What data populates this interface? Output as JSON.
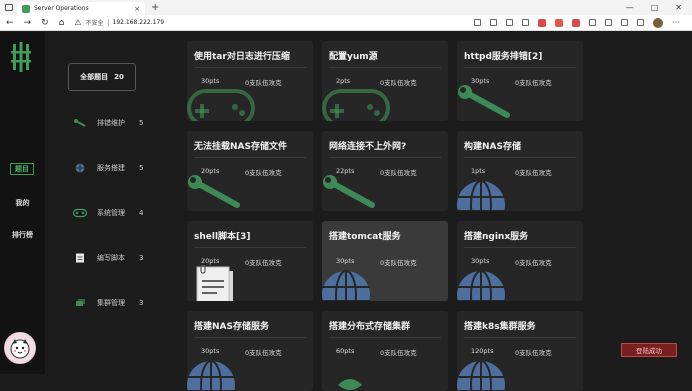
{
  "browser": {
    "tab_title": "Server Operations",
    "tab_close": "×",
    "new_tab": "+",
    "insecure_label": "不安全",
    "url": "192.168.222.179"
  },
  "rail": {
    "items": [
      {
        "label": "题目",
        "active": true
      },
      {
        "label": "我的",
        "active": false
      },
      {
        "label": "排行榜",
        "active": false
      }
    ]
  },
  "categories": {
    "all": {
      "label": "全部题目",
      "count": "20"
    },
    "items": [
      {
        "label": "排错维护",
        "count": "5",
        "icon": "wrench-icon"
      },
      {
        "label": "服务搭建",
        "count": "5",
        "icon": "globe-icon"
      },
      {
        "label": "系统管理",
        "count": "4",
        "icon": "gamepad-icon"
      },
      {
        "label": "编写脚本",
        "count": "3",
        "icon": "document-icon"
      },
      {
        "label": "集群管理",
        "count": "3",
        "icon": "cluster-icon"
      }
    ]
  },
  "challenges": [
    {
      "title": "使用tar对日志进行压缩",
      "pts": "30pts",
      "solves": "0支队伍攻克",
      "icon": "gamepad-icon"
    },
    {
      "title": "配置yum源",
      "pts": "2pts",
      "solves": "0支队伍攻克",
      "icon": "gamepad-icon"
    },
    {
      "title": "httpd服务排错[2]",
      "pts": "30pts",
      "solves": "0支队伍攻克",
      "icon": "wrench-icon"
    },
    {
      "title": "无法挂载NAS存储文件",
      "pts": "20pts",
      "solves": "0支队伍攻克",
      "icon": "wrench-icon"
    },
    {
      "title": "网络连接不上外网?",
      "pts": "22pts",
      "solves": "0支队伍攻克",
      "icon": "wrench-icon"
    },
    {
      "title": "构建NAS存储",
      "pts": "1pts",
      "solves": "0支队伍攻克",
      "icon": "globe-icon"
    },
    {
      "title": "shell脚本[3]",
      "pts": "20pts",
      "solves": "0支队伍攻克",
      "icon": "document-icon"
    },
    {
      "title": "搭建tomcat服务",
      "pts": "30pts",
      "solves": "0支队伍攻克",
      "icon": "globe-icon"
    },
    {
      "title": "搭建nginx服务",
      "pts": "30pts",
      "solves": "0支队伍攻克",
      "icon": "globe-icon"
    },
    {
      "title": "搭建NAS存储服务",
      "pts": "30pts",
      "solves": "0支队伍攻克",
      "icon": "globe-icon"
    },
    {
      "title": "搭建分布式存储集群",
      "pts": "60pts",
      "solves": "0支队伍攻克",
      "icon": "cluster-icon"
    },
    {
      "title": "搭建k8s集群服务",
      "pts": "120pts",
      "solves": "0支队伍攻克",
      "icon": "globe-icon"
    }
  ],
  "toast": {
    "label": "登陆成功"
  },
  "colors": {
    "accent": "#3f9c59",
    "wrench": "#3d8a57",
    "globe": "#4e6e9e",
    "toast_bg": "#7a1f1f"
  }
}
